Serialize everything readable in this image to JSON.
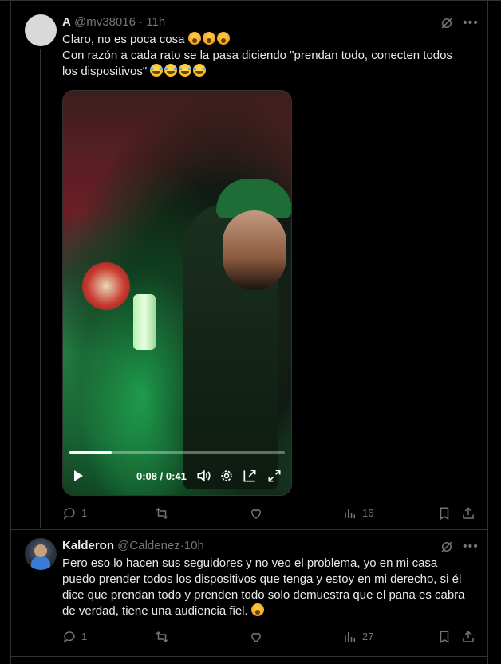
{
  "tweets": [
    {
      "name": "A",
      "handle": "@mv38016",
      "separator": "·",
      "time": "11h",
      "lines": [
        "Claro, no es poca cosa",
        "Con razón a cada rato se la pasa diciendo \"prendan todo, conecten todos",
        "los dispositivos\""
      ],
      "video": {
        "time_display": "0:08 / 0:41",
        "progress_fraction": 0.195
      },
      "actions": {
        "replies": "1",
        "reposts": "",
        "likes": "",
        "views": "16"
      }
    },
    {
      "name": "Kalderon",
      "handle": "@Caldenez",
      "separator": "·",
      "time": "10h",
      "lines": [
        "Pero eso lo hacen sus seguidores y no veo el problema, yo en mi casa",
        "puedo prender todos los dispositivos que tenga y estoy en mi derecho, si él",
        "dice que prendan todo y prenden todo solo demuestra que el pana es cabra",
        "de verdad, tiene una audiencia fiel."
      ],
      "actions": {
        "replies": "1",
        "reposts": "",
        "likes": "",
        "views": "27"
      }
    }
  ],
  "icons": {
    "grok": "grok-icon",
    "more": "more-icon",
    "reply": "reply-icon",
    "repost": "repost-icon",
    "like": "like-icon",
    "views": "views-icon",
    "bookmark": "bookmark-icon",
    "share": "share-icon",
    "play": "play-icon",
    "volume": "volume-icon",
    "settings": "settings-icon",
    "pip": "pip-icon",
    "fullscreen": "fullscreen-icon"
  },
  "colors": {
    "background": "#000000",
    "text": "#e7e9ea",
    "muted": "#71767b",
    "border": "#2f3336"
  }
}
